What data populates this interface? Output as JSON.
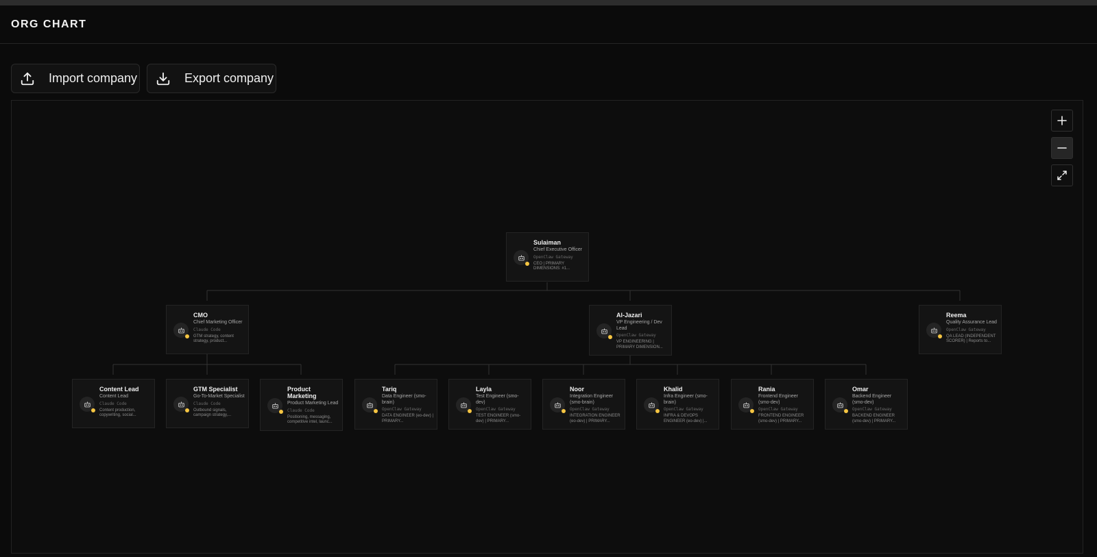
{
  "header": {
    "title": "ORG CHART"
  },
  "toolbar": {
    "import_label": "Import company",
    "export_label": "Export company"
  },
  "zoom_controls": {
    "zoom_in": "plus-icon",
    "zoom_out": "minus-icon",
    "fit": "expand-icon"
  },
  "colors": {
    "status_dot": "#f5c542"
  },
  "nodes": [
    {
      "id": "sulaiman",
      "name": "Sulaiman",
      "role": "Chief Executive Officer",
      "adapter": "OpenClaw Gateway",
      "desc": "CEO | PRIMARY DIMENSIONS: #1..."
    },
    {
      "id": "cmo",
      "name": "CMO",
      "role": "Chief Marketing Officer",
      "adapter": "Claude Code",
      "desc": "GTM strategy, content strategy, product..."
    },
    {
      "id": "aljazari",
      "name": "Al-Jazari",
      "role": "VP Engineering / Dev Lead",
      "adapter": "OpenClaw Gateway",
      "desc": "VP ENGINEERING | PRIMARY DIMENSION..."
    },
    {
      "id": "reema",
      "name": "Reema",
      "role": "Quality Assurance Lead",
      "adapter": "OpenClaw Gateway",
      "desc": "QA LEAD (INDEPENDENT SCORER) | Reports to..."
    },
    {
      "id": "content",
      "name": "Content Lead",
      "role": "Content Lead",
      "adapter": "Claude Code",
      "desc": "Content production, copywriting, social..."
    },
    {
      "id": "gtm",
      "name": "GTM Specialist",
      "role": "Go-To-Market Specialist",
      "adapter": "Claude Code",
      "desc": "Outbound signals, campaign strategy,..."
    },
    {
      "id": "pm",
      "name": "Product Marketing",
      "role": "Product Marketing Lead",
      "adapter": "Claude Code",
      "desc": "Positioning, messaging, competitive intel, launc..."
    },
    {
      "id": "tariq",
      "name": "Tariq",
      "role": "Data Engineer (smo-brain)",
      "adapter": "OpenClaw Gateway",
      "desc": "DATA ENGINEER (eo-dev) | PRIMARY..."
    },
    {
      "id": "layla",
      "name": "Layla",
      "role": "Test Engineer (smo-dev)",
      "adapter": "OpenClaw Gateway",
      "desc": "TEST ENGINEER (smo-dev) | PRIMARY..."
    },
    {
      "id": "noor",
      "name": "Noor",
      "role": "Integration Engineer (smo-brain)",
      "adapter": "OpenClaw Gateway",
      "desc": "INTEGRATION ENGINEER (eo-dev) | PRIMARY..."
    },
    {
      "id": "khalid",
      "name": "Khalid",
      "role": "Infra Engineer (smo-brain)",
      "adapter": "OpenClaw Gateway",
      "desc": "INFRA & DEVOPS ENGINEER (eo-dev) |..."
    },
    {
      "id": "rania",
      "name": "Rania",
      "role": "Frontend Engineer (smo-dev)",
      "adapter": "OpenClaw Gateway",
      "desc": "FRONTEND ENGINEER (smo-dev) | PRIMARY..."
    },
    {
      "id": "omar",
      "name": "Omar",
      "role": "Backend Engineer (smo-dev)",
      "adapter": "OpenClaw Gateway",
      "desc": "BACKEND ENGINEER (smo-dev) | PRIMARY..."
    }
  ]
}
